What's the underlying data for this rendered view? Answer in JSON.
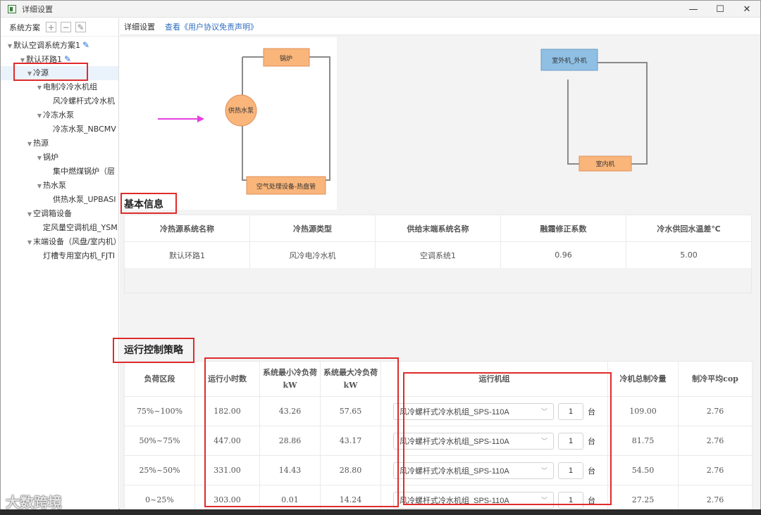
{
  "window": {
    "title": "详细设置"
  },
  "sidebar": {
    "toolbar_label": "系统方案",
    "add_symbol": "+",
    "remove_symbol": "−",
    "edit_symbol": "✎",
    "tree": [
      {
        "label": "默认空调系统方案1",
        "level": 0,
        "caret": true,
        "pencil": true
      },
      {
        "label": "默认环路1",
        "level": 1,
        "caret": true,
        "pencil": true
      },
      {
        "label": "冷源",
        "level": 2,
        "caret": true,
        "selected": true
      },
      {
        "label": "电制冷冷水机组",
        "level": 3,
        "caret": true
      },
      {
        "label": "风冷螺杆式冷水机",
        "level": 4,
        "caret": false
      },
      {
        "label": "冷冻水泵",
        "level": 3,
        "caret": true
      },
      {
        "label": "冷冻水泵_NBCMV",
        "level": 4,
        "caret": false
      },
      {
        "label": "热源",
        "level": 2,
        "caret": true
      },
      {
        "label": "锅炉",
        "level": 3,
        "caret": true
      },
      {
        "label": "集中燃煤锅炉（层",
        "level": 4,
        "caret": false
      },
      {
        "label": "热水泵",
        "level": 3,
        "caret": true
      },
      {
        "label": "供热水泵_UPBASI",
        "level": 4,
        "caret": false
      },
      {
        "label": "空调箱设备",
        "level": 2,
        "caret": true
      },
      {
        "label": "定风量空调机组_YSM",
        "level": 3,
        "caret": false
      },
      {
        "label": "末端设备（风盘/室内机）",
        "level": 2,
        "caret": true
      },
      {
        "label": "灯槽专用室内机_FJTI",
        "level": 3,
        "caret": false
      }
    ]
  },
  "header": {
    "tab": "详细设置",
    "link": "查看《用户协议免责声明》"
  },
  "diagram": {
    "boiler": "锅炉",
    "pump": "供热水泵",
    "ahu": "空气处理设备-热盘管",
    "outdoor": "室外机_外机",
    "indoor": "室内机",
    "arrow_color": "#e83ee0"
  },
  "basic_info": {
    "title": "基本信息",
    "headers": [
      "冷热源系统名称",
      "冷热源类型",
      "供给末端系统名称",
      "融霜修正系数",
      "冷水供回水温差℃"
    ],
    "row": [
      "默认环路1",
      "风冷电冷水机",
      "空调系统1",
      "0.96",
      "5.00"
    ]
  },
  "control": {
    "title": "运行控制策略",
    "headers": {
      "load_range": "负荷区段",
      "hours": "运行小时数",
      "min_load": "系统最小冷负荷kW",
      "max_load": "系统最大冷负荷kW",
      "units": "运行机组",
      "total_cap": "冷机总制冷量",
      "avg_cop": "制冷平均cop"
    },
    "rows": [
      {
        "range": "75%~100%",
        "hours": "182.00",
        "min": "43.26",
        "max": "57.65",
        "unit": "风冷螺杆式冷水机组_SPS-110A",
        "qty": "1",
        "qty_unit": "台",
        "cap": "109.00",
        "cop": "2.76"
      },
      {
        "range": "50%~75%",
        "hours": "447.00",
        "min": "28.86",
        "max": "43.17",
        "unit": "风冷螺杆式冷水机组_SPS-110A",
        "qty": "1",
        "qty_unit": "台",
        "cap": "81.75",
        "cop": "2.76"
      },
      {
        "range": "25%~50%",
        "hours": "331.00",
        "min": "14.43",
        "max": "28.80",
        "unit": "风冷螺杆式冷水机组_SPS-110A",
        "qty": "1",
        "qty_unit": "台",
        "cap": "54.50",
        "cop": "2.76"
      },
      {
        "range": "0~25%",
        "hours": "303.00",
        "min": "0.01",
        "max": "14.24",
        "unit": "风冷螺杆式冷水机组_SPS-110A",
        "qty": "1",
        "qty_unit": "台",
        "cap": "27.25",
        "cop": "2.76"
      }
    ]
  },
  "watermark": "大数跨境",
  "colors": {
    "highlight": "#e02b2b",
    "link": "#2d6cc0",
    "boiler_fill": "#f9b57a",
    "outdoor_fill": "#8fbfe3"
  }
}
